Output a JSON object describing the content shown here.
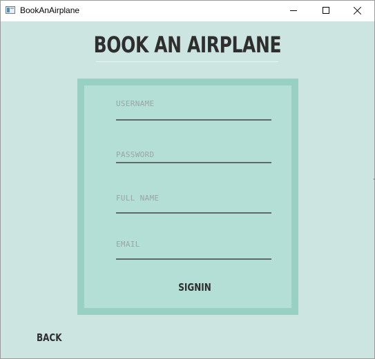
{
  "window": {
    "title": "BookAnAirplane",
    "minimize_icon": "minimize-icon",
    "maximize_icon": "maximize-icon",
    "close_icon": "close-icon"
  },
  "page": {
    "title": "BOOK AN AIRPLANE"
  },
  "form": {
    "fields": [
      {
        "label": "USERNAME",
        "value": ""
      },
      {
        "label": "PASSWORD",
        "value": ""
      },
      {
        "label": "FULL NAME",
        "value": ""
      },
      {
        "label": "EMAIL",
        "value": ""
      }
    ],
    "signin_label": "SIGNIN"
  },
  "footer": {
    "back_label": "BACK"
  },
  "colors": {
    "background": "#cce5e0",
    "panel_border": "#98d0c3",
    "panel_fill": "#b4dfd6",
    "text_dark": "#2e2e2e",
    "placeholder": "#9aa5a3",
    "field_line": "#5e6866"
  }
}
